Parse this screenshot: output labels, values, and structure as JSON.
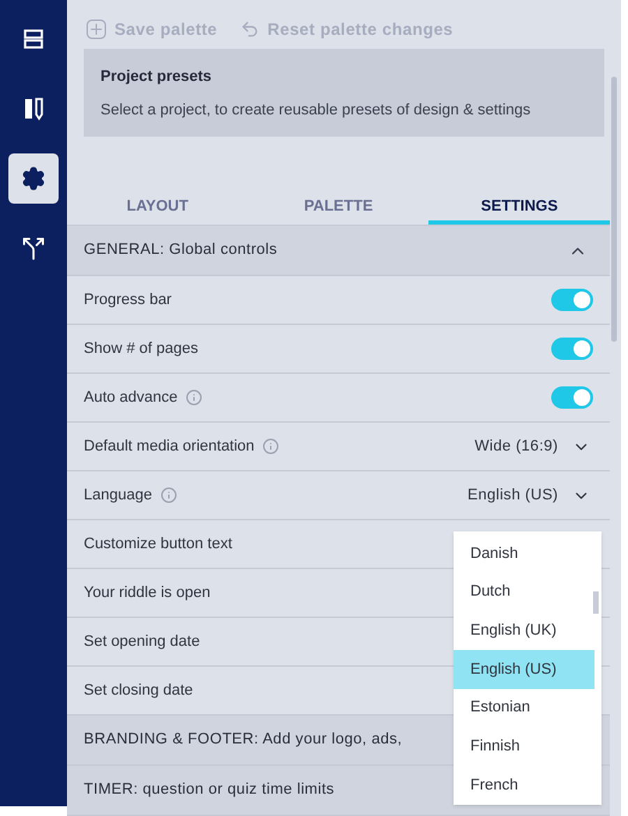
{
  "sidebar": {
    "items": [
      {
        "kind": "menu",
        "selected": false
      },
      {
        "kind": "design",
        "selected": false
      },
      {
        "kind": "settings",
        "selected": true
      },
      {
        "kind": "branch",
        "selected": false
      }
    ]
  },
  "toolbar": {
    "buttons": [
      {
        "kind": "save",
        "label": "Save palette"
      },
      {
        "kind": "reset",
        "label": "Reset palette changes"
      }
    ]
  },
  "presets": {
    "title": "Project presets",
    "description": "Select a project, to create reusable presets of design & settings"
  },
  "tabs": [
    {
      "label": "LAYOUT",
      "selected": false
    },
    {
      "label": "PALETTE",
      "selected": false
    },
    {
      "label": "SETTINGS",
      "selected": true
    }
  ],
  "sections": [
    {
      "title": "GENERAL: Global controls",
      "expanded": true,
      "rows": [
        {
          "kind": "toggle",
          "label": "Progress bar",
          "on": true,
          "info": false
        },
        {
          "kind": "toggle",
          "label": "Show # of pages",
          "on": true,
          "info": false
        },
        {
          "kind": "toggle",
          "label": "Auto advance",
          "on": true,
          "info": true
        },
        {
          "kind": "select",
          "label": "Default media orientation",
          "value": "Wide (16:9)",
          "info": true
        },
        {
          "kind": "select",
          "label": "Language",
          "value": "English (US)",
          "info": true
        },
        {
          "kind": "plain",
          "label": "Customize button text",
          "info": false
        },
        {
          "kind": "plain",
          "label": "Your riddle is open",
          "info": false
        },
        {
          "kind": "plain",
          "label": "Set opening date",
          "info": false
        },
        {
          "kind": "plain",
          "label": "Set closing date",
          "info": false
        }
      ]
    },
    {
      "title": "BRANDING & FOOTER: Add your logo, ads,",
      "expanded": false
    },
    {
      "title": "TIMER: question or quiz time limits",
      "expanded": false
    }
  ],
  "language_dropdown": {
    "options": [
      {
        "label": "Danish",
        "selected": false
      },
      {
        "label": "Dutch",
        "selected": false
      },
      {
        "label": "English (UK)",
        "selected": false
      },
      {
        "label": "English (US)",
        "selected": true
      },
      {
        "label": "Estonian",
        "selected": false
      },
      {
        "label": "Finnish",
        "selected": false
      },
      {
        "label": "French",
        "selected": false
      }
    ]
  }
}
